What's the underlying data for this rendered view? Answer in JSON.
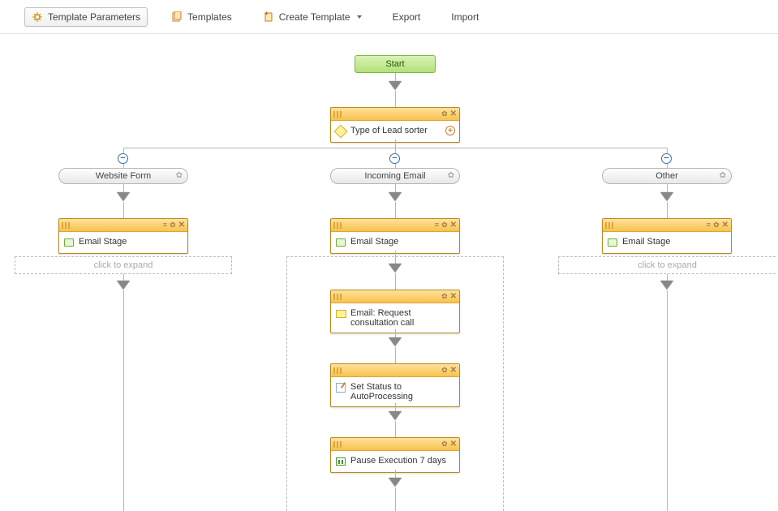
{
  "toolbar": {
    "template_parameters": "Template Parameters",
    "templates": "Templates",
    "create_template": "Create Template",
    "export": "Export",
    "import": "Import"
  },
  "start": {
    "label": "Start"
  },
  "sorter": {
    "label": "Type of Lead sorter"
  },
  "branches": {
    "left": {
      "label": "Website Form"
    },
    "middle": {
      "label": "Incoming Email"
    },
    "right": {
      "label": "Other"
    }
  },
  "email_stage": "Email Stage",
  "expand": "click to expand",
  "middle_nodes": {
    "n1": "Email: Request consultation call",
    "n2": "Set Status to AutoProcessing",
    "n3": "Pause Execution 7 days"
  }
}
